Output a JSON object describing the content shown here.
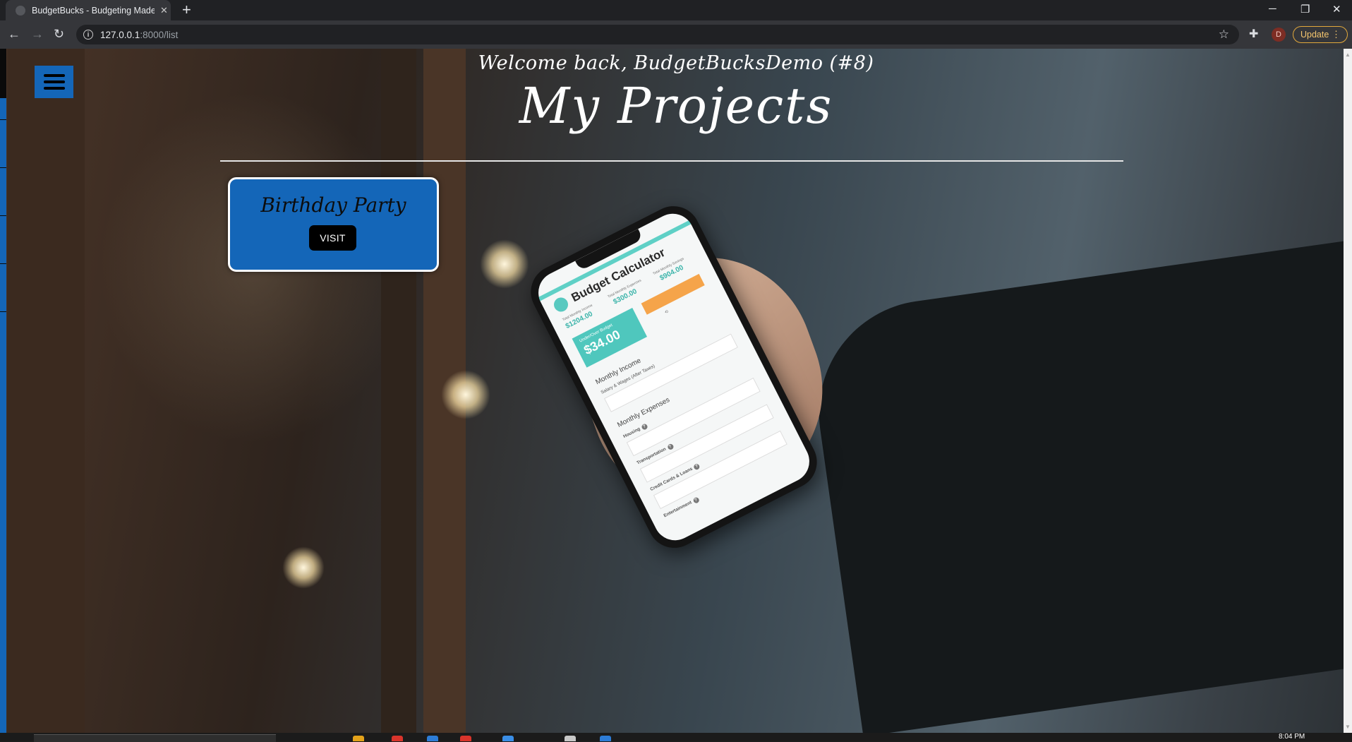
{
  "browser": {
    "tab_title": "BudgetBucks - Budgeting Made E",
    "tab_close": "✕",
    "new_tab": "+",
    "url_host": "127.0.0.1",
    "url_rest": ":8000/list",
    "update_label": "Update",
    "minimize": "─",
    "restore": "❐",
    "close": "✕",
    "profile_initial": "D"
  },
  "page": {
    "welcome": "Welcome back, BudgetBucksDemo (#8)",
    "title": "My Projects",
    "projects": [
      {
        "name": "Birthday Party",
        "button_label": "VISIT"
      }
    ]
  },
  "phone_app": {
    "title": "Budget Calculator",
    "income_label": "Total Monthly Income",
    "income": "$1204.00",
    "expenses_label": "Total Monthly Expenses",
    "expenses": "$300.00",
    "savings_label": "Total Monthly Savings",
    "savings": "$904.00",
    "over_under_label": "Under/Over Budget",
    "over_under": "$34.00",
    "monthly_income": "Monthly Income",
    "salary": "Salary & Wages (After Taxes)",
    "monthly_expenses": "Monthly Expenses",
    "housing": "Housing",
    "transportation": "Transportation",
    "credit": "Credit Cards & Loans",
    "entertainment": "Entertainment"
  },
  "taskbar": {
    "clock": "8:04 PM"
  },
  "colors": {
    "accent_blue": "#1466b8",
    "button_black": "#000000",
    "update_orange": "#e2a83c"
  }
}
